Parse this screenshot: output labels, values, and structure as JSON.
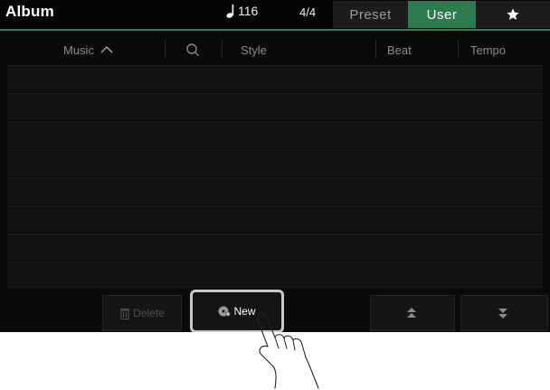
{
  "header": {
    "title": "Album",
    "tempo_value": "116",
    "time_signature": "4/4",
    "tabs": [
      {
        "label": "Preset",
        "active": false
      },
      {
        "label": "User",
        "active": true
      },
      {
        "label": "",
        "icon": "star-icon",
        "active": false
      }
    ],
    "accent_color": "#2e7a4f"
  },
  "columns": {
    "music": "Music",
    "style": "Style",
    "beat": "Beat",
    "tempo": "Tempo"
  },
  "rows": [
    {
      "music": "",
      "style": "",
      "beat": "",
      "tempo": ""
    },
    {
      "music": "",
      "style": "",
      "beat": "",
      "tempo": ""
    },
    {
      "music": "",
      "style": "",
      "beat": "",
      "tempo": ""
    },
    {
      "music": "",
      "style": "",
      "beat": "",
      "tempo": ""
    },
    {
      "music": "",
      "style": "",
      "beat": "",
      "tempo": ""
    },
    {
      "music": "",
      "style": "",
      "beat": "",
      "tempo": ""
    },
    {
      "music": "",
      "style": "",
      "beat": "",
      "tempo": ""
    },
    {
      "music": "",
      "style": "",
      "beat": "",
      "tempo": ""
    }
  ],
  "buttons": {
    "delete_label": "Delete",
    "new_label": "New",
    "page_up_icon": "page-up-icon",
    "page_down_icon": "page-down-icon"
  }
}
